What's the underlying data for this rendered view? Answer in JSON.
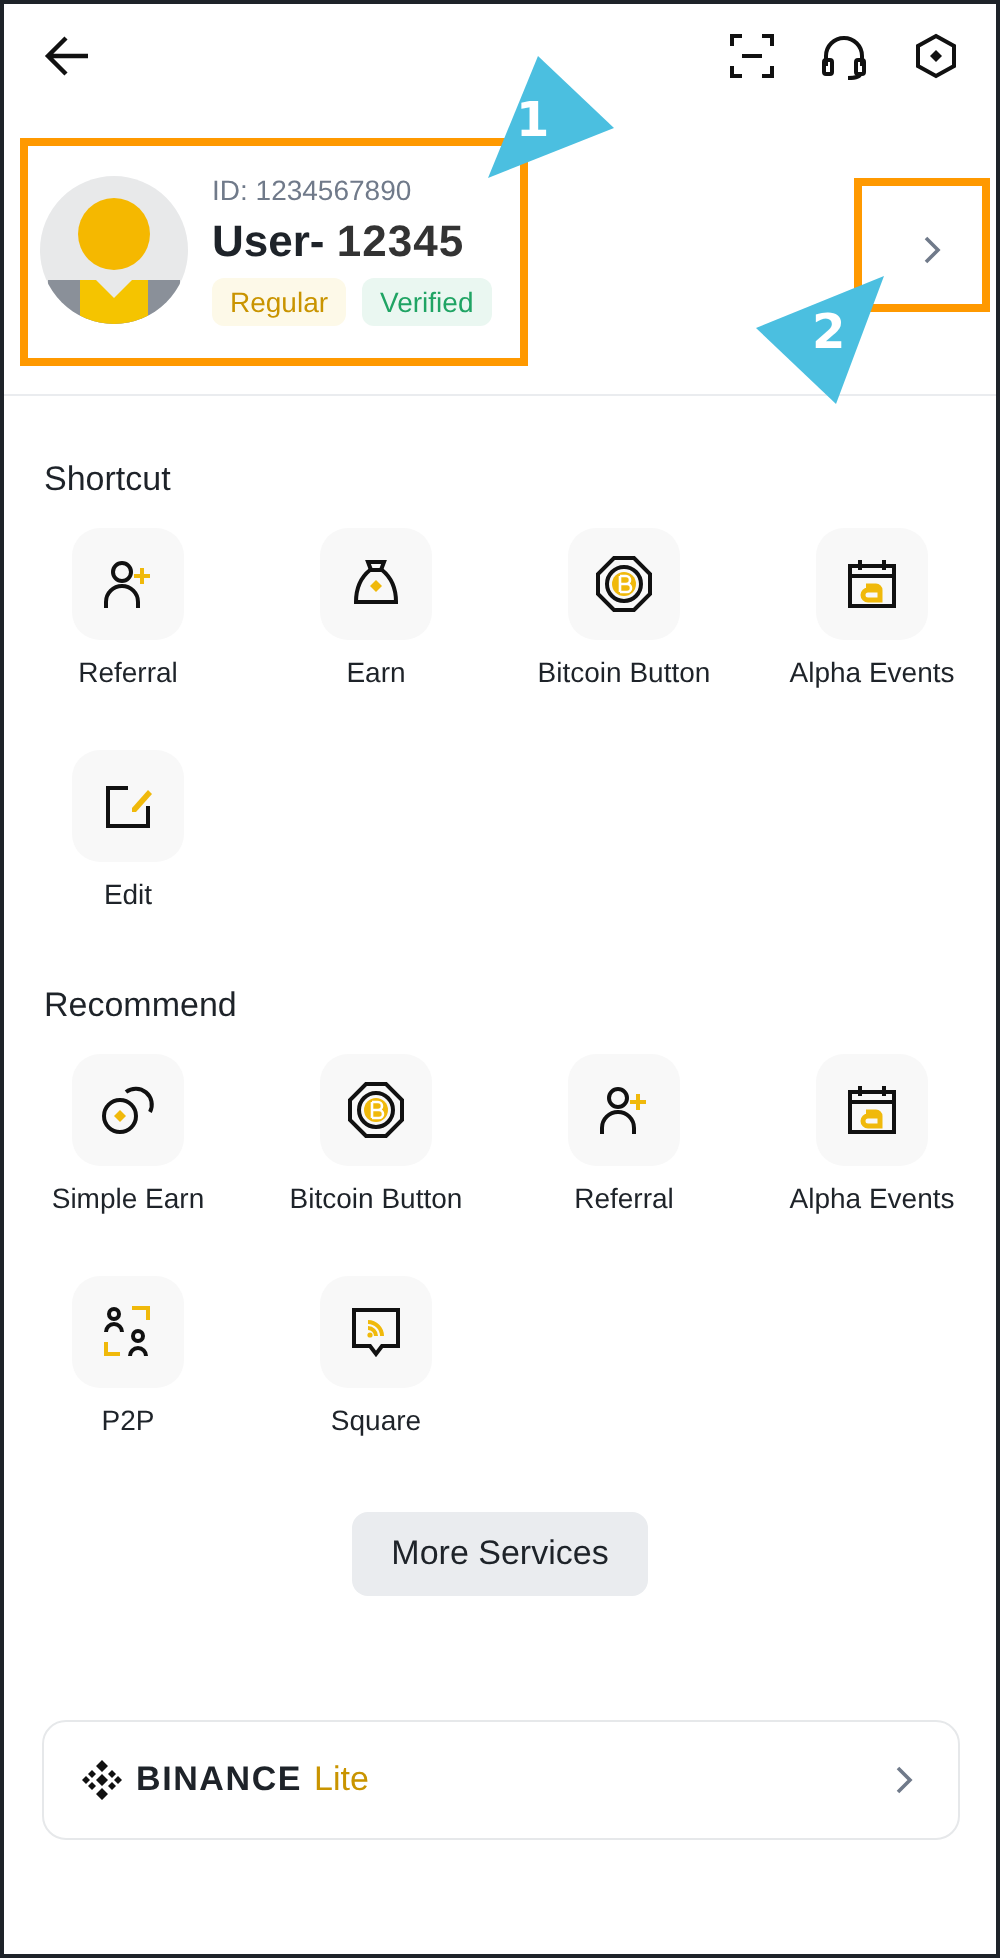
{
  "profile": {
    "id": "ID: 1234567890",
    "name": "User-",
    "number": "12345",
    "tags": [
      {
        "label": "Regular",
        "kind": "tier"
      },
      {
        "label": "Verified",
        "kind": "verified"
      }
    ]
  },
  "sections": [
    {
      "title": "Shortcut",
      "items": [
        {
          "label": "Referral",
          "kind": "referral"
        },
        {
          "label": "Earn",
          "kind": "earn"
        },
        {
          "label": "Bitcoin Button",
          "kind": "bitcoin"
        },
        {
          "label": "Alpha Events",
          "kind": "alpha"
        },
        {
          "label": "Edit",
          "kind": "edit"
        }
      ]
    },
    {
      "title": "Recommend",
      "items": [
        {
          "label": "Simple Earn",
          "kind": "simple-earn"
        },
        {
          "label": "Bitcoin Button",
          "kind": "bitcoin"
        },
        {
          "label": "Referral",
          "kind": "referral"
        },
        {
          "label": "Alpha Events",
          "kind": "alpha"
        },
        {
          "label": "P2P",
          "kind": "p2p"
        },
        {
          "label": "Square",
          "kind": "square"
        }
      ]
    }
  ],
  "more_button": "More Services",
  "lite_card": {
    "brand": "BINANCE",
    "suffix": "Lite"
  },
  "annotations": [
    {
      "label": "1"
    },
    {
      "label": "2"
    }
  ]
}
